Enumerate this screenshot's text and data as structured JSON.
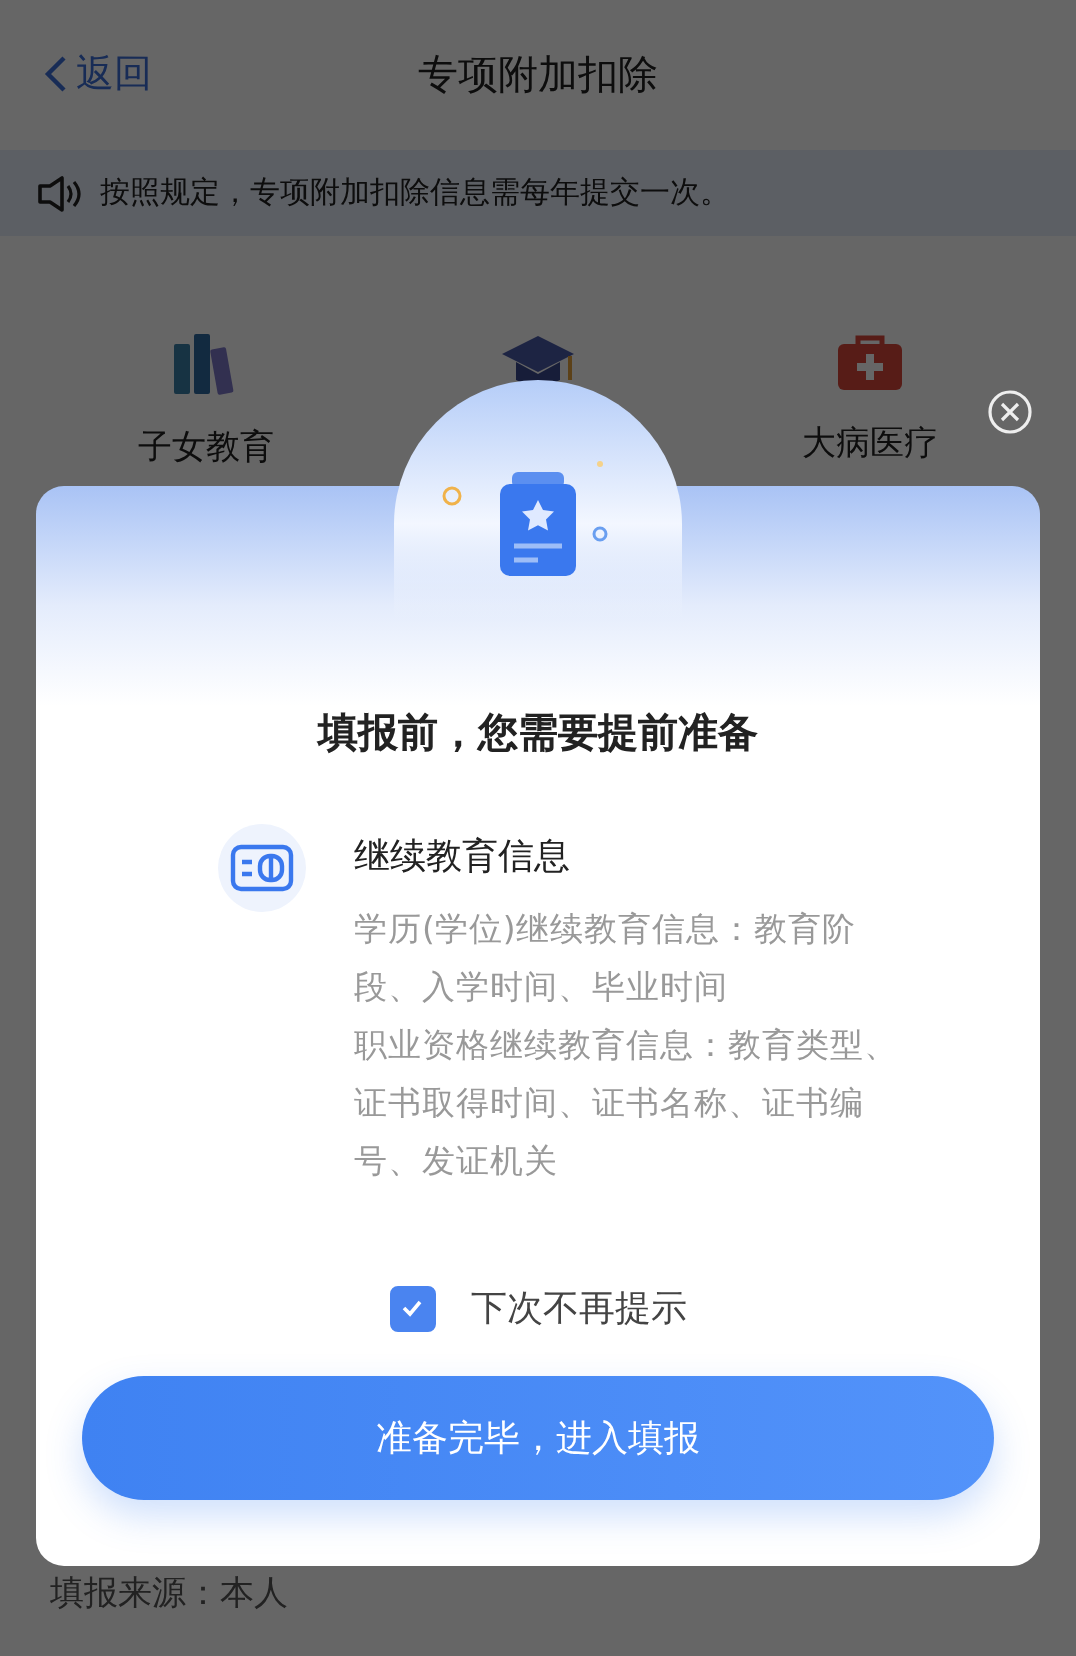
{
  "header": {
    "back": "返回",
    "title": "专项附加扣除"
  },
  "notice": {
    "text": "按照规定，专项附加扣除信息需每年提交一次。"
  },
  "categories": [
    {
      "kind": "books",
      "label": "子女教育"
    },
    {
      "kind": "cap"
    },
    {
      "kind": "medkit",
      "label": "大病医疗"
    }
  ],
  "record": {
    "source": "填报来源：本人"
  },
  "dialog": {
    "title": "填报前，您需要提前准备",
    "item": {
      "title": "继续教育信息",
      "lines": [
        "学历(学位)继续教育信息：教育阶段、入学时间、毕业时间",
        "职业资格继续教育信息：教育类型、证书取得时间、证书名称、证书编号、发证机关"
      ]
    },
    "dont_show_again": {
      "label": "下次不再提示",
      "checked": true
    },
    "confirm": "准备完毕，进入填报"
  }
}
